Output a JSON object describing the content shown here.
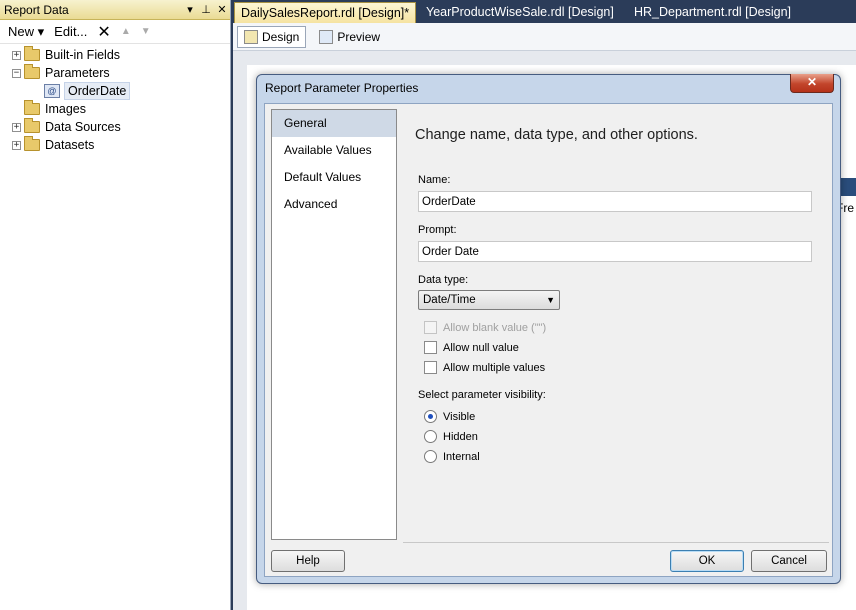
{
  "left_panel": {
    "title": "Report Data",
    "pin_icon": "pin-icon",
    "toolbar": {
      "new_label": "New ▾",
      "edit_label": "Edit...",
      "delete_glyph": "✕",
      "up_glyph": "▲",
      "down_glyph": "▼"
    },
    "tree": [
      {
        "label": "Built-in Fields",
        "expander": "+"
      },
      {
        "label": "Parameters",
        "expander": "−"
      },
      {
        "label": "OrderDate"
      },
      {
        "label": "Images"
      },
      {
        "label": "Data Sources",
        "expander": "+"
      },
      {
        "label": "Datasets",
        "expander": "+"
      }
    ]
  },
  "tabs": [
    {
      "label": "DailySalesReport.rdl [Design]*",
      "active": true
    },
    {
      "label": "YearProductWiseSale.rdl [Design]"
    },
    {
      "label": "HR_Department.rdl [Design]"
    }
  ],
  "design_tabs": {
    "design": "Design",
    "preview": "Preview"
  },
  "background": {
    "partial_text": "Fre"
  },
  "dialog": {
    "title": "Report Parameter Properties",
    "close_glyph": "✕",
    "nav": [
      "General",
      "Available Values",
      "Default Values",
      "Advanced"
    ],
    "heading": "Change name, data type, and other options.",
    "name_label": "Name:",
    "name_value": "OrderDate",
    "prompt_label": "Prompt:",
    "prompt_value": "Order Date",
    "data_type_label": "Data type:",
    "data_type_value": "Date/Time",
    "checkboxes": [
      {
        "label": "Allow blank value (\"\")",
        "checked": false,
        "disabled": true
      },
      {
        "label": "Allow null value",
        "checked": false,
        "disabled": false
      },
      {
        "label": "Allow multiple values",
        "checked": false,
        "disabled": false
      }
    ],
    "visibility_label": "Select parameter visibility:",
    "visibility_options": [
      {
        "label": "Visible",
        "selected": true
      },
      {
        "label": "Hidden",
        "selected": false
      },
      {
        "label": "Internal",
        "selected": false
      }
    ],
    "help_label": "Help",
    "ok_label": "OK",
    "cancel_label": "Cancel"
  }
}
